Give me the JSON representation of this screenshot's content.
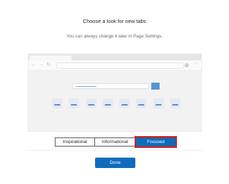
{
  "dialog": {
    "title": "Choose a look for new tabs",
    "subtitle": "You can always change it later in Page Settings."
  },
  "preview": {
    "icons": {
      "back": "back-arrow-icon",
      "forward": "forward-arrow-icon",
      "refresh": "refresh-icon",
      "profile": "profile-icon",
      "more": "more-icon"
    },
    "tile_count": 8
  },
  "layout_options": [
    {
      "label": "Inspirational",
      "selected": false
    },
    {
      "label": "Informational",
      "selected": false
    },
    {
      "label": "Focused",
      "selected": true
    }
  ],
  "actions": {
    "done_label": "Done"
  },
  "colors": {
    "accent": "#0f6cbd",
    "focus_outline": "#d11f26"
  }
}
